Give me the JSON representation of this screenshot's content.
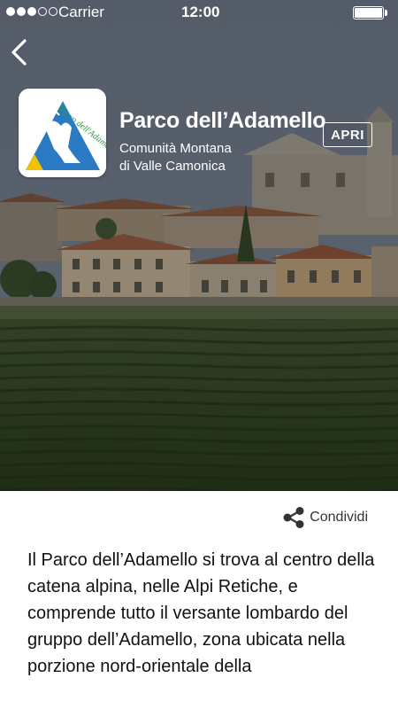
{
  "status_bar": {
    "carrier": "Carrier",
    "time": "12:00",
    "signal_bars_filled": 3,
    "signal_bars_total": 5,
    "battery_level": 1.0
  },
  "header": {
    "back_icon": "chevron-left-icon"
  },
  "app": {
    "title": "Parco dell’Adamello",
    "subtitle_line1": "Comunità Montana",
    "subtitle_line2": "di Valle Camonica",
    "open_label": "APRI",
    "logo_text": "Parco dell'Adamello"
  },
  "actions": {
    "share_label": "Condividi",
    "share_icon": "share-icon"
  },
  "description": {
    "text": "Il Parco dell’Adamello si trova al centro della catena alpina, nelle Alpi Retiche, e comprende tutto il versante lombardo del gruppo dell’Adamello, zona ubicata nella porzione nord-orientale della"
  },
  "colors": {
    "logo_blue": "#2b7bc4",
    "logo_yellow": "#f2c200",
    "logo_green": "#2a9a3a",
    "hero_overlay": "#2c3440"
  }
}
